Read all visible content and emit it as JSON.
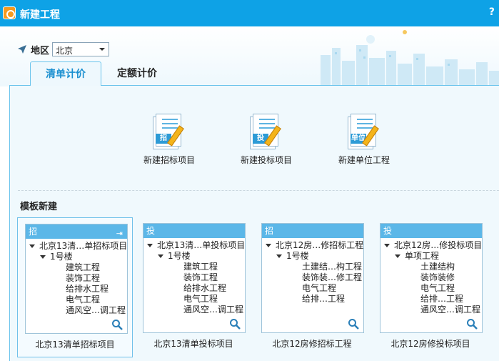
{
  "window": {
    "title": "新建工程",
    "help_label": "?"
  },
  "region": {
    "label": "地区",
    "selected": "北京"
  },
  "tabs": [
    {
      "label": "清单计价",
      "active": true
    },
    {
      "label": "定额计价",
      "active": false
    }
  ],
  "new_items": [
    {
      "tag": "招",
      "label": "新建招标项目"
    },
    {
      "tag": "投",
      "label": "新建投标项目"
    },
    {
      "tag": "单位",
      "label": "新建单位工程"
    }
  ],
  "template_section": {
    "title": "模板新建"
  },
  "templates": [
    {
      "badge": "招",
      "root": "北京13清…单招标项目",
      "child": "1号楼",
      "leaves": [
        "建筑工程",
        "装饰工程",
        "给排水工程",
        "电气工程",
        "通风空…调工程"
      ],
      "label": "北京13清单招标项目"
    },
    {
      "badge": "投",
      "root": "北京13清…单投标项目",
      "child": "1号楼",
      "leaves": [
        "建筑工程",
        "装饰工程",
        "给排水工程",
        "电气工程",
        "通风空…调工程"
      ],
      "label": "北京13清单投标项目"
    },
    {
      "badge": "招",
      "root": "北京12房…修招标工程",
      "child": "1号楼",
      "leaves": [
        "土建结…构工程",
        "装饰装…修工程",
        "电气工程",
        "给排…工程"
      ],
      "label": "北京12房修招标工程"
    },
    {
      "badge": "投",
      "root": "北京12房…修投标项目",
      "child": "单项工程",
      "leaves": [
        "土建结构",
        "装饰装修",
        "电气工程",
        "给排…工程",
        "通风空…调工程"
      ],
      "label": "北京12房修投标项目"
    }
  ],
  "colors": {
    "titlebar": "#0ea2e6",
    "accent": "#1a8fd0",
    "card_header": "#5bb7e8"
  }
}
